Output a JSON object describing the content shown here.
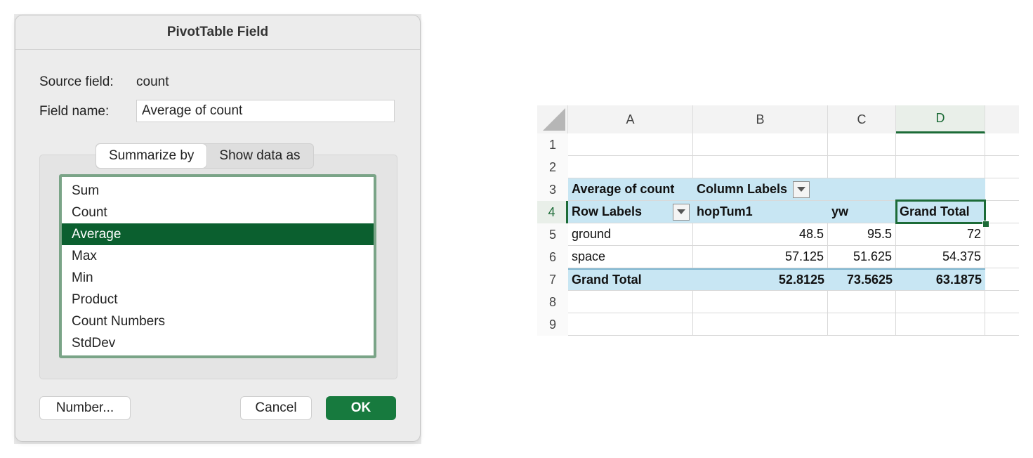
{
  "dialog": {
    "title": "PivotTable Field",
    "source_label": "Source field:",
    "source_value": "count",
    "name_label": "Field name:",
    "name_value": "Average of count",
    "tabs": [
      "Summarize by",
      "Show data as"
    ],
    "active_tab": "Summarize by",
    "functions": [
      "Sum",
      "Count",
      "Average",
      "Max",
      "Min",
      "Product",
      "Count Numbers",
      "StdDev"
    ],
    "selected_function": "Average",
    "number_button": "Number...",
    "cancel_button": "Cancel",
    "ok_button": "OK",
    "selection_color": "#0b5f2f",
    "ok_color": "#177a3e"
  },
  "sheet": {
    "columns": [
      "A",
      "B",
      "C",
      "D"
    ],
    "active_column": "D",
    "rows": [
      "1",
      "2",
      "3",
      "4",
      "5",
      "6",
      "7",
      "8",
      "9"
    ],
    "active_row": "4",
    "pivot": {
      "value_field": "Average of count",
      "column_labels": "Column Labels",
      "row_labels": "Row Labels",
      "col_headers": [
        "hopTum1",
        "yw",
        "Grand Total"
      ],
      "rows": [
        {
          "label": "ground",
          "values": [
            "48.5",
            "95.5",
            "72"
          ]
        },
        {
          "label": "space",
          "values": [
            "57.125",
            "51.625",
            "54.375"
          ]
        }
      ],
      "grand_total": {
        "label": "Grand Total",
        "values": [
          "52.8125",
          "73.5625",
          "63.1875"
        ]
      }
    },
    "band_color": "#c8e6f3",
    "accent_color": "#1c6b37"
  }
}
